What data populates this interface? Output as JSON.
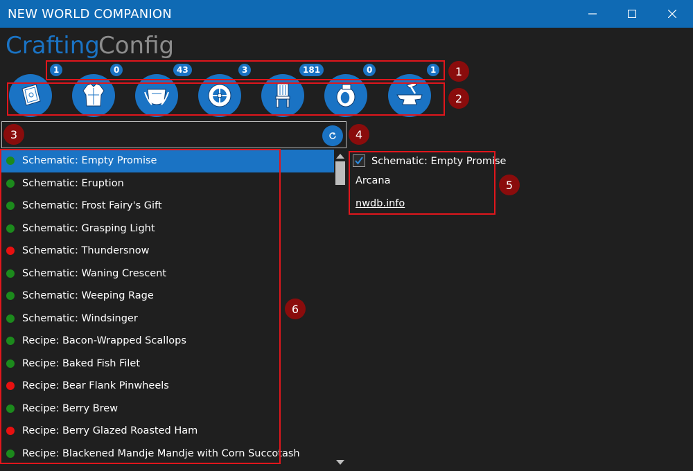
{
  "window": {
    "title": "NEW WORLD COMPANION",
    "buttons": [
      {
        "name": "minimize",
        "icon": "minimize-icon"
      },
      {
        "name": "maximize",
        "icon": "maximize-icon"
      },
      {
        "name": "close",
        "icon": "close-icon"
      }
    ]
  },
  "tabs": [
    {
      "label": "Crafting",
      "active": true
    },
    {
      "label": "Config",
      "active": false
    }
  ],
  "categories": [
    {
      "icon": "arcana-book-icon",
      "count": "1"
    },
    {
      "icon": "armoring-armor-icon",
      "count": "0"
    },
    {
      "icon": "cooking-pot-icon",
      "count": "43"
    },
    {
      "icon": "engineering-gear-icon",
      "count": "3"
    },
    {
      "icon": "furnishing-chair-icon",
      "count": "181"
    },
    {
      "icon": "jewelcrafting-ring-icon",
      "count": "0"
    },
    {
      "icon": "weaponsmithing-anvil-icon",
      "count": "1"
    }
  ],
  "search": {
    "value": "",
    "placeholder": "",
    "refresh_icon": "refresh-icon"
  },
  "colors": {
    "accent": "#1a73c4",
    "titlebar": "#0f6ab4",
    "background": "#1f1f1f",
    "status_green": "#1c8a1c",
    "status_red": "#e81010",
    "annotation_red": "#e1161c",
    "annotation_marker": "#8a0c0c"
  },
  "list": {
    "items": [
      {
        "label": "Schematic: Empty Promise",
        "status": "green",
        "selected": true
      },
      {
        "label": "Schematic: Eruption",
        "status": "green",
        "selected": false
      },
      {
        "label": "Schematic: Frost Fairy's Gift",
        "status": "green",
        "selected": false
      },
      {
        "label": "Schematic: Grasping Light",
        "status": "green",
        "selected": false
      },
      {
        "label": "Schematic: Thundersnow",
        "status": "red",
        "selected": false
      },
      {
        "label": "Schematic: Waning Crescent",
        "status": "green",
        "selected": false
      },
      {
        "label": "Schematic: Weeping Rage",
        "status": "green",
        "selected": false
      },
      {
        "label": "Schematic: Windsinger",
        "status": "green",
        "selected": false
      },
      {
        "label": "Recipe: Bacon-Wrapped Scallops",
        "status": "green",
        "selected": false
      },
      {
        "label": "Recipe: Baked Fish Filet",
        "status": "green",
        "selected": false
      },
      {
        "label": "Recipe: Bear Flank Pinwheels",
        "status": "red",
        "selected": false
      },
      {
        "label": "Recipe: Berry Brew",
        "status": "green",
        "selected": false
      },
      {
        "label": "Recipe: Berry Glazed Roasted Ham",
        "status": "red",
        "selected": false
      },
      {
        "label": "Recipe: Blackened Mandje Mandje with Corn Succotash",
        "status": "green",
        "selected": false
      }
    ]
  },
  "detail": {
    "checked": true,
    "title": "Schematic: Empty Promise",
    "category": "Arcana",
    "link": "nwdb.info"
  },
  "annotations": [
    "1",
    "2",
    "3",
    "4",
    "5",
    "6"
  ]
}
